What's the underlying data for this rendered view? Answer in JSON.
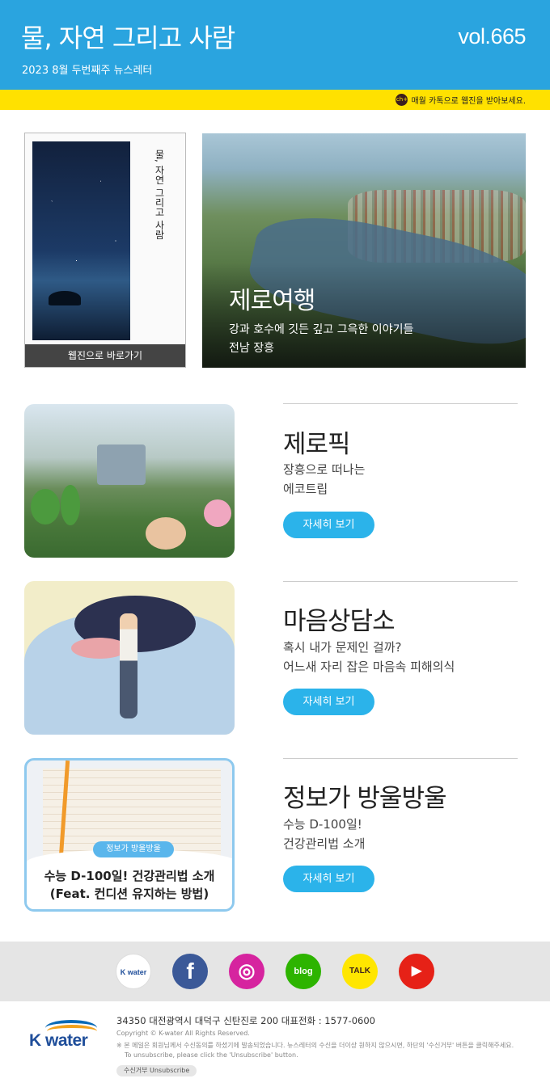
{
  "header": {
    "title": "물, 자연 그리고 사람",
    "subtitle": "2023 8월 두번째주 뉴스레터",
    "volume": "vol.665",
    "kakao_badge": "ch+",
    "kakao_notice": "매월 카톡으로 웹진을 받아보세요."
  },
  "cover": {
    "vertical_title": "물, 자연 그리고 사람",
    "button_label": "웹진으로 바로가기"
  },
  "hero": {
    "title": "제로여행",
    "desc_line1": "강과 호수에 깃든 깊고 그윽한 이야기들",
    "desc_line2": "전남 장흥"
  },
  "sections": [
    {
      "title": "제로픽",
      "desc_line1": "장흥으로 떠나는",
      "desc_line2": "에코트립",
      "button_label": "자세히 보기"
    },
    {
      "title": "마음상담소",
      "desc_line1": "혹시 내가 문제인 걸까?",
      "desc_line2": "어느새 자리 잡은 마음속 피해의식",
      "button_label": "자세히 보기"
    },
    {
      "title": "정보가 방울방울",
      "desc_line1": "수능 D-100일!",
      "desc_line2": "건강관리법 소개",
      "button_label": "자세히 보기",
      "image_tag": "정보가 방울방울",
      "image_caption1": "수능 D-100일! 건강관리법 소개",
      "image_caption2": "(Feat. 컨디션 유지하는 방법)"
    }
  ],
  "social": [
    {
      "name": "kwater",
      "label": "K water",
      "color": "#ffffff"
    },
    {
      "name": "facebook",
      "label": "f",
      "color": "#3b5998"
    },
    {
      "name": "instagram",
      "label": "◎",
      "color": "#d6249f"
    },
    {
      "name": "blog",
      "label": "blog",
      "color": "#2db400"
    },
    {
      "name": "kakaotalk",
      "label": "TALK",
      "color": "#ffe600"
    },
    {
      "name": "youtube",
      "label": "▶",
      "color": "#e62117"
    }
  ],
  "footer": {
    "logo_text": "K water",
    "address": "34350 대전광역시 대덕구 신탄진로 200  대표전화 : 1577-0600",
    "copyright": "Copyright © K-water All Rights Reserved.",
    "note1": "※ 본 메일은 회원님께서 수신동의를 하셨기에 발송되었습니다. 뉴스레터의 수신을 더이상 원하지 않으시면, 하단의 '수신거부' 버튼을 클릭해주세요.",
    "note2": "To unsubscribe, please click the 'Unsubscribe' button.",
    "unsubscribe_label": "수신거부  Unsubscribe"
  }
}
